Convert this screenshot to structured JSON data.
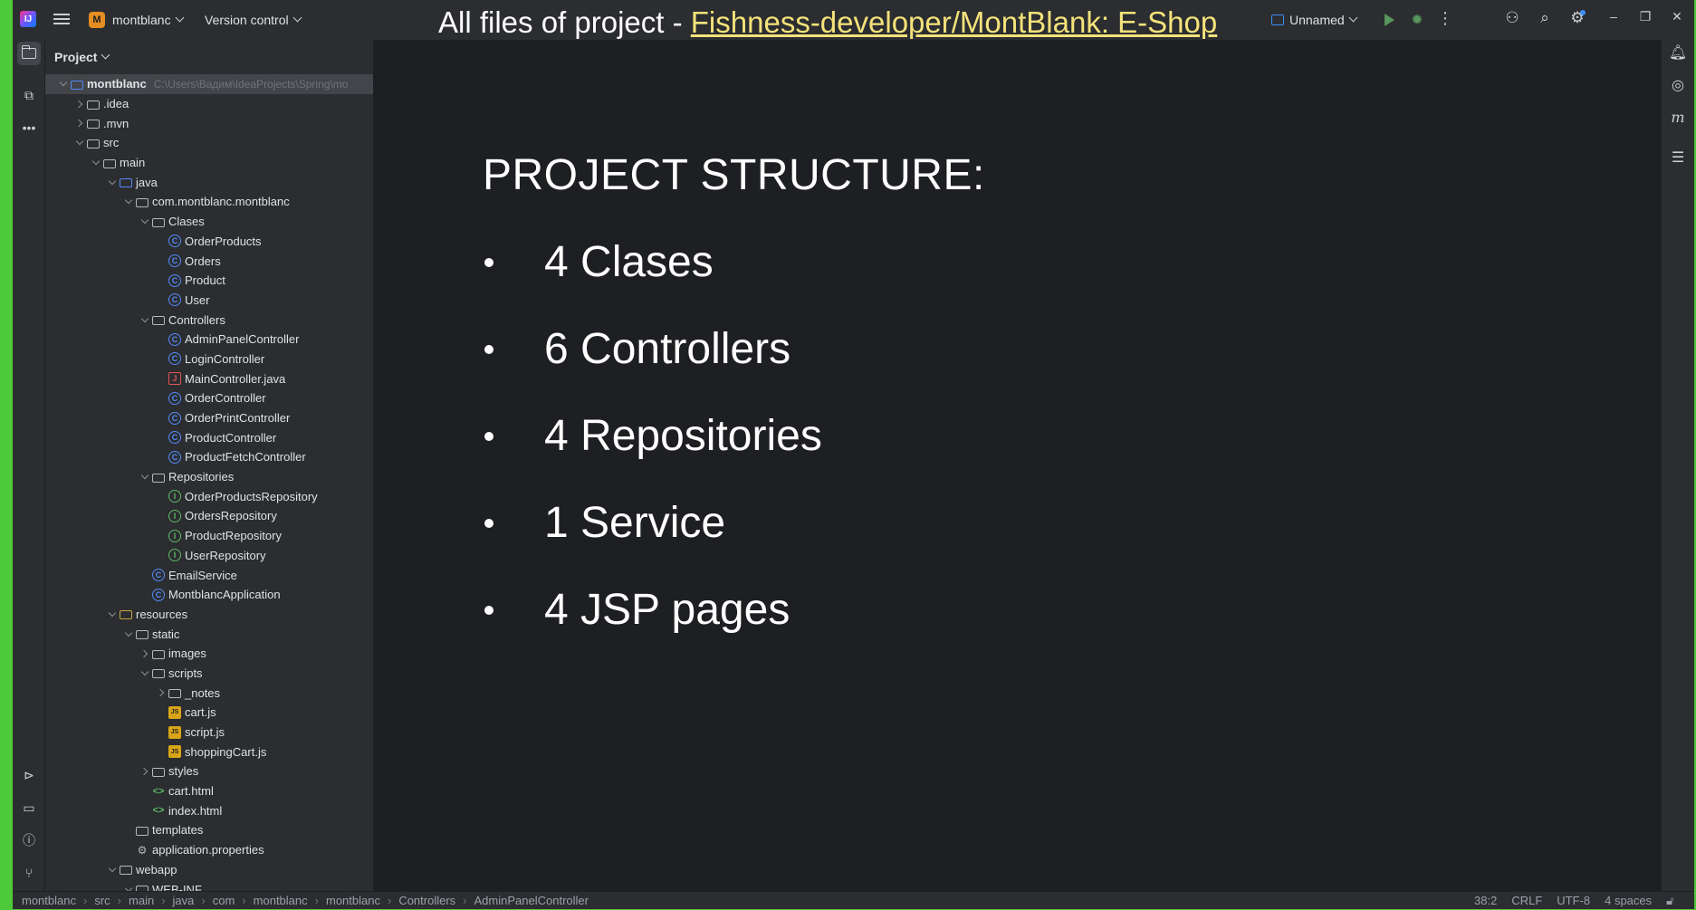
{
  "titlebar": {
    "project_badge": "M",
    "project_name": "montblanc",
    "vcs_label": "Version control",
    "title_prefix": "All files of project - ",
    "title_link": "Fishness-developer/MontBlank: E-Shop",
    "run_config": "Unnamed"
  },
  "panel": {
    "title": "Project"
  },
  "tree": {
    "root_name": "montblanc",
    "root_path": "C:\\Users\\Вадим\\IdeaProjects\\Spring\\mo",
    "idea": ".idea",
    "mvn": ".mvn",
    "src": "src",
    "main": "main",
    "java": "java",
    "pkg": "com.montblanc.montblanc",
    "clases": "Clases",
    "clases_items": [
      "OrderProducts",
      "Orders",
      "Product",
      "User"
    ],
    "controllers": "Controllers",
    "controllers_items": [
      "AdminPanelController",
      "LoginController",
      "MainController.java",
      "OrderController",
      "OrderPrintController",
      "ProductController",
      "ProductFetchController"
    ],
    "repositories": "Repositories",
    "repositories_items": [
      "OrderProductsRepository",
      "OrdersRepository",
      "ProductRepository",
      "UserRepository"
    ],
    "email_service": "EmailService",
    "app_class": "MontblancApplication",
    "resources": "resources",
    "static": "static",
    "images": "images",
    "scripts": "scripts",
    "notes": "_notes",
    "scripts_items": [
      "cart.js",
      "script.js",
      "shoppingCart.js"
    ],
    "styles": "styles",
    "cart_html": "cart.html",
    "index_html": "index.html",
    "templates": "templates",
    "app_props": "application.properties",
    "webapp": "webapp",
    "web_inf": "WEB-INF"
  },
  "slide": {
    "title": "PROJECT STRUCTURE:",
    "bullets": [
      "4 Clases",
      "6 Controllers",
      "4 Repositories",
      "1 Service",
      "4 JSP pages"
    ]
  },
  "statusbar": {
    "crumbs": [
      "montblanc",
      "src",
      "main",
      "java",
      "com",
      "montblanc",
      "montblanc",
      "Controllers",
      "AdminPanelController"
    ],
    "position": "38:2",
    "line_sep": "CRLF",
    "encoding": "UTF-8",
    "indent": "4 spaces"
  },
  "colors": {
    "frame_border": "#4dc93a",
    "title_link": "#f4e27a",
    "run_green": "#57965c",
    "accent_blue": "#3d8ef6",
    "project_badge": "#e38d22"
  }
}
